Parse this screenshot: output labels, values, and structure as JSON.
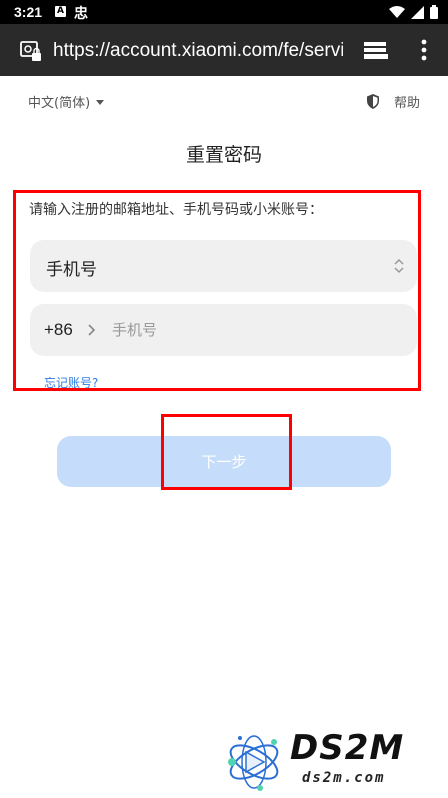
{
  "status_bar": {
    "time": "3:21",
    "notification_a": "A",
    "notification_b": "忠"
  },
  "browser": {
    "url": "https://account.xiaomi.com/fe/service/forgetPassword",
    "site_icon": "page-info-icon",
    "tabs_icon": "tab-switcher-icon",
    "menu_icon": "more-vert-icon"
  },
  "header": {
    "language": "中文(简体)",
    "help": "帮助"
  },
  "page": {
    "title": "重置密码",
    "instruction": "请输入注册的邮箱地址、手机号码或小米账号：",
    "account_type": "手机号",
    "country_code": "+86",
    "phone_placeholder": "手机号",
    "forgot_account": "忘记账号?",
    "next_button": "下一步"
  },
  "watermark": {
    "brand": "DS2M",
    "domain": "ds2m.com"
  },
  "colors": {
    "accent": "#2f7de1",
    "button_disabled": "#c5dcfb",
    "field_bg": "#f0f0f0",
    "annotation_red": "#ff0000"
  }
}
